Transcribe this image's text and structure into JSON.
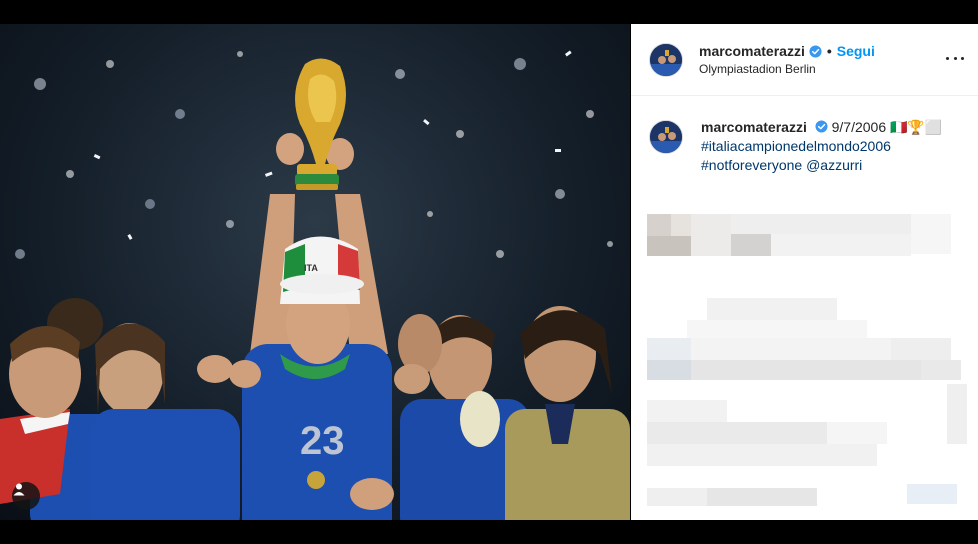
{
  "post": {
    "username": "marcomaterazzi",
    "follow_label": "Segui",
    "separator": "•",
    "location": "Olympiastadion Berlin",
    "caption_date": "9/7/2006",
    "caption_emoji": "🇮🇹🏆⬜",
    "hashtag1": "#italiacampionedelmondo2006",
    "hashtag2": "#notforeveryone",
    "mention": "@azzurri"
  },
  "colors": {
    "follow_blue": "#0095f6",
    "link_blue": "#00376b",
    "verified_blue": "#3897f0",
    "italy_shirt": "#1d4fb0"
  },
  "icons": {
    "verified": "verified-badge-icon",
    "more": "more-options-icon",
    "user_tag": "user-tag-icon"
  }
}
